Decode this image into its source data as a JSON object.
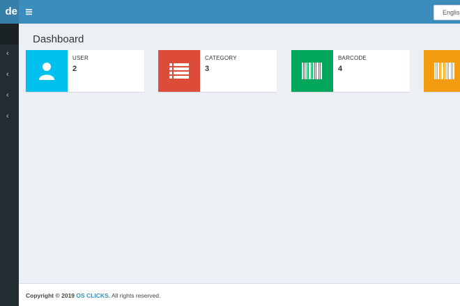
{
  "brand": {
    "text": "de"
  },
  "navbar": {
    "toggle_icon": "hamburger-icon",
    "language": "English"
  },
  "sidebar": {
    "items": [
      {
        "icon": "chevron-left-icon",
        "glyph": "‹"
      },
      {
        "icon": "chevron-left-icon",
        "glyph": "‹"
      },
      {
        "icon": "chevron-left-icon",
        "glyph": "‹"
      },
      {
        "icon": "chevron-left-icon",
        "glyph": "‹"
      }
    ]
  },
  "page": {
    "title": "Dashboard"
  },
  "info_boxes": [
    {
      "label": "USER",
      "value": "2",
      "color": "#00c0ef",
      "icon": "user-icon"
    },
    {
      "label": "CATEGORY",
      "value": "3",
      "color": "#dd4b39",
      "icon": "list-icon"
    },
    {
      "label": "BARCODE",
      "value": "4",
      "color": "#00a65a",
      "icon": "barcode-icon"
    },
    {
      "label": "",
      "value": "",
      "color": "#f39c12",
      "icon": "barcode-icon"
    }
  ],
  "footer": {
    "prefix": "Copyright © 2019",
    "company": "OS CLICKS.",
    "suffix": "All rights reserved."
  }
}
